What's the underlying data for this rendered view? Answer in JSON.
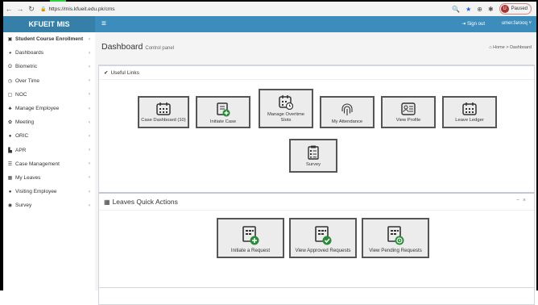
{
  "browser": {
    "url": "https://mis.kfueit.edu.pk/cms",
    "profile_initial": "U",
    "paused_label": "Paused"
  },
  "app": {
    "brand": "KFUEIT MIS",
    "sign_out": "Sign out",
    "user": "umer.farooq"
  },
  "sidebar": {
    "items": [
      {
        "label": "Student Course Enrollment",
        "icon": "clipboard-icon"
      },
      {
        "label": "Dashboards",
        "icon": "palette-icon"
      },
      {
        "label": "Biometric",
        "icon": "fingerprint-icon"
      },
      {
        "label": "Over Time",
        "icon": "clock-icon"
      },
      {
        "label": "NOC",
        "icon": "file-icon"
      },
      {
        "label": "Manage Employee",
        "icon": "users-icon"
      },
      {
        "label": "Meeting",
        "icon": "gear-icon"
      },
      {
        "label": "ORIC",
        "icon": "circle-icon"
      },
      {
        "label": "APR",
        "icon": "file-solid-icon"
      },
      {
        "label": "Case Management",
        "icon": "list-icon"
      },
      {
        "label": "My Leaves",
        "icon": "calendar-icon"
      },
      {
        "label": "Visiting Employee",
        "icon": "circle-icon"
      },
      {
        "label": "Survey",
        "icon": "survey-icon"
      }
    ]
  },
  "page": {
    "title": "Dashboard",
    "subtitle": "Control panel",
    "breadcrumb_home": "Home",
    "breadcrumb_sep": ">",
    "breadcrumb_current": "Dashboard"
  },
  "useful_links": {
    "title": "Useful Links",
    "tiles": [
      {
        "label": "Case Dashboard (10)",
        "icon": "calendar-grid-icon"
      },
      {
        "label": "Initiate Case",
        "icon": "file-plus-icon"
      },
      {
        "label": "Manage Overtime Slots",
        "icon": "calendar-clock-icon"
      },
      {
        "label": "My Attendance",
        "icon": "fingerprint-icon"
      },
      {
        "label": "View Profile",
        "icon": "id-card-icon"
      },
      {
        "label": "Leave Ledger",
        "icon": "calendar-grid-icon"
      },
      {
        "label": "Survey",
        "icon": "survey-icon"
      }
    ]
  },
  "leaves": {
    "title": "Leaves Quick Actions",
    "tiles": [
      {
        "label": "Initiate a Request",
        "icon": "request-add-icon"
      },
      {
        "label": "View Approved Requests",
        "icon": "request-approved-icon"
      },
      {
        "label": "View Pending Requests",
        "icon": "request-pending-icon"
      }
    ]
  }
}
